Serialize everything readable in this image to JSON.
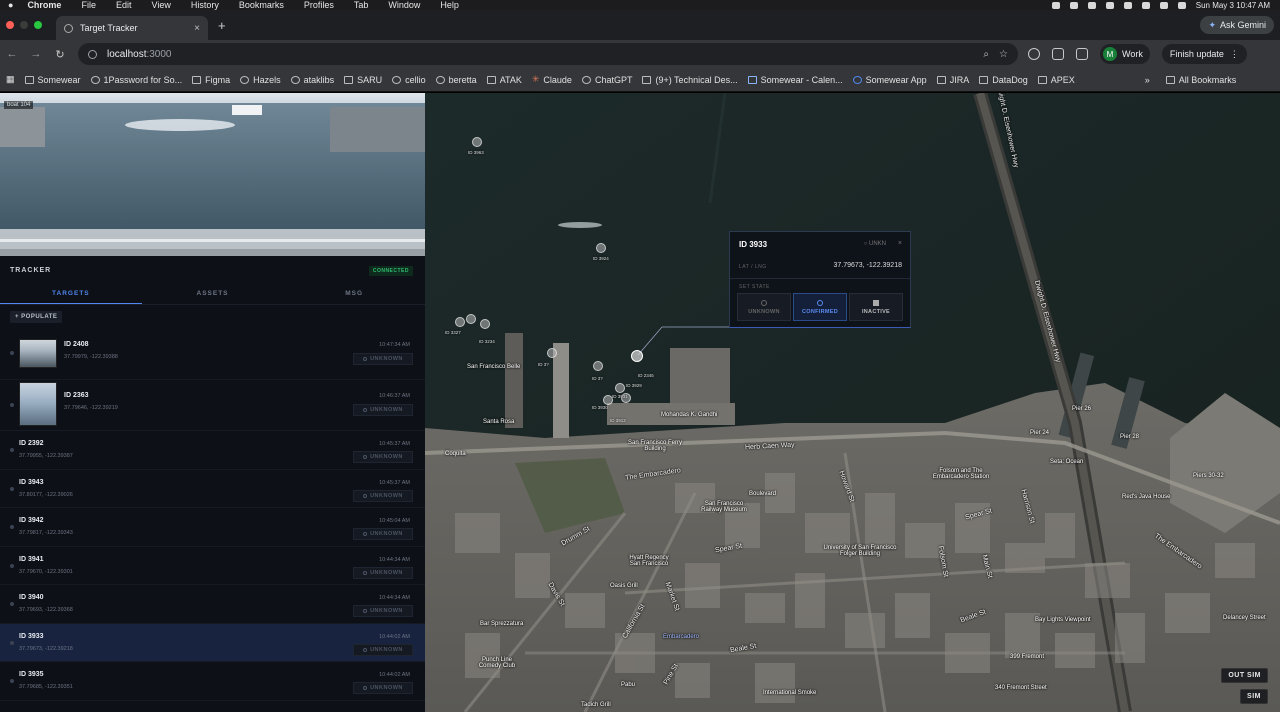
{
  "menubar": {
    "app": "Chrome",
    "items": [
      "File",
      "Edit",
      "View",
      "History",
      "Bookmarks",
      "Profiles",
      "Tab",
      "Window",
      "Help"
    ],
    "clock": "Sun May 3  10:47 AM"
  },
  "tabstrip": {
    "tab_title": "Target Tracker",
    "ask_gemini": "Ask Gemini"
  },
  "toolbar": {
    "url_host": "localhost",
    "url_port": ":3000",
    "profile_initial": "M",
    "profile_label": "Work",
    "finish_update": "Finish update"
  },
  "bookmarks": {
    "items": [
      "Somewear",
      "1Password for So...",
      "Figma",
      "Hazels",
      "ataklibs",
      "SARU",
      "cellio",
      "beretta",
      "ATAK",
      "Claude",
      "ChatGPT",
      "(9+) Technical Des...",
      "Somewear - Calen...",
      "Somewear App",
      "JIRA",
      "DataDog",
      "APEX"
    ],
    "more": "»",
    "all": "All Bookmarks"
  },
  "video": {
    "label": "boat 104"
  },
  "panel": {
    "title": "TRACKER",
    "status": "CONNECTED",
    "tabs": [
      "TARGETS",
      "ASSETS",
      "MSG"
    ],
    "populate": "+ POPULATE",
    "rows": [
      {
        "id": "ID 2408",
        "coord": "37.79979, -122.39388",
        "time": "10:47:34 AM",
        "status": "UNKNOWN"
      },
      {
        "id": "ID 2363",
        "coord": "37.79646, -122.39219",
        "time": "10:46:37 AM",
        "status": "UNKNOWN"
      },
      {
        "id": "ID 2392",
        "coord": "37.79955, -122.39387",
        "time": "10:45:37 AM",
        "status": "UNKNOWN"
      },
      {
        "id": "ID 3943",
        "coord": "37.80177, -122.39026",
        "time": "10:45:37 AM",
        "status": "UNKNOWN"
      },
      {
        "id": "ID 3942",
        "coord": "37.79817, -122.39343",
        "time": "10:45:04 AM",
        "status": "UNKNOWN"
      },
      {
        "id": "ID 3941",
        "coord": "37.79670, -122.39301",
        "time": "10:44:34 AM",
        "status": "UNKNOWN"
      },
      {
        "id": "ID 3940",
        "coord": "37.79693, -122.39368",
        "time": "10:44:34 AM",
        "status": "UNKNOWN"
      },
      {
        "id": "ID 3933",
        "coord": "37.79673, -122.39218",
        "time": "10:44:02 AM",
        "status": "UNKNOWN"
      },
      {
        "id": "ID 3935",
        "coord": "37.79685, -122.39351",
        "time": "10:44:02 AM",
        "status": "UNKNOWN"
      }
    ]
  },
  "popup": {
    "title": "ID 3933",
    "state": "UNKN",
    "close": "×",
    "latlng_label": "LAT / LNG",
    "latlng_value": "37.79673, -122.39218",
    "set_state_label": "SET STATE",
    "buttons": [
      "UNKNOWN",
      "CONFIRMED",
      "INACTIVE"
    ]
  },
  "map": {
    "ids": [
      "ID 3963",
      "ID 3924",
      "ID 3234",
      "ID 3327",
      "ID 3?",
      "ID 2345",
      "ID 3929",
      "ID 3931",
      "ID 3912",
      "ID 3930",
      "ID 3?"
    ],
    "labels": {
      "ferry_building": "San Francisco Ferry Building",
      "sf_belle": "San Francisco Belle",
      "santa_rosa": "Santa Rosa",
      "gandhi": "Mohandas K. Gandhi",
      "coquita": "Coquita",
      "embarcadero": "The Embarcadero",
      "embarcadero2": "The Embarcadero",
      "herb_caen": "Herb Caen Way",
      "railway_museum": "San Francisco Railway Museum",
      "boulevard": "Boulevard",
      "hyatt": "Hyatt Regency San Francisco",
      "oasis": "Oasis Grill",
      "bar_sprezz": "Bar Sprezzatura",
      "punch_line": "Punch Line Comedy Club",
      "embarcadero_station": "Embarcadero",
      "international_smoke": "International Smoke",
      "folsom_station": "Folsom and The Embarcadero Station",
      "university": "University of San Francisco Folger Building",
      "spear_st": "Spear St",
      "spear_st2": "Spear St",
      "drumm_st": "Drumm St",
      "beale_st": "Beale St",
      "beale_st2": "Beale St",
      "howard_st": "Howard St",
      "harrison_st": "Harrison St",
      "folsom_st": "Folsom St",
      "pier26": "Pier 26",
      "pier28": "Pier 28",
      "piers3032": "Piers 30-32",
      "reds": "Red's Java House",
      "delancey": "Delancey Street",
      "bay_lights": "Bay Lights Viewpoint",
      "fremont399": "399 Fremont",
      "fremont340": "340 Fremont Street",
      "eisenhower": "Dwight D. Eisenhower Hwy",
      "eisenhower2": "Dwight D. Eisenhower Hwy",
      "main_st": "Main St",
      "market_st": "Market St",
      "pine_st": "Pine St",
      "davis_st": "Davis St",
      "california_st": "California St",
      "pabu": "Pabu",
      "tadich": "Tadich Grill",
      "setai": "Seta: Ocean",
      "pier24": "Pier 24"
    },
    "out_sim": "OUT SIM",
    "sim": "SIM"
  }
}
